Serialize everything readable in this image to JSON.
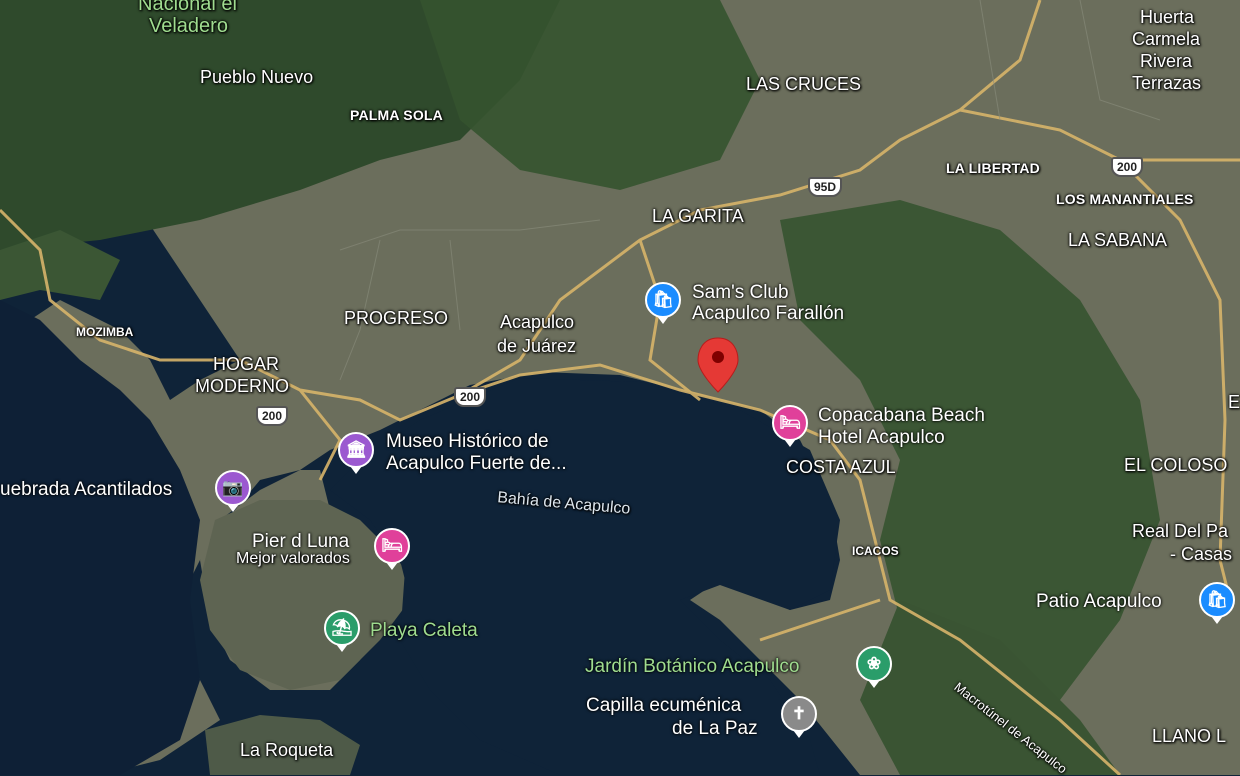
{
  "labels": {
    "nacional": "Nacional el",
    "veladero": "Veladero",
    "pueblo_nuevo": "Pueblo Nuevo",
    "palma_sola": "PALMA SOLA",
    "las_cruces": "LAS CRUCES",
    "huerta": "Huerta",
    "carmela": "Carmela",
    "rivera": "Rivera",
    "terrazas": "Terrazas",
    "la_libertad": "LA LIBERTAD",
    "los_manantiales": "LOS MANANTIALES",
    "la_garita": "LA GARITA",
    "la_sabana": "LA SABANA",
    "mozimba": "MOZIMBA",
    "progreso": "PROGRESO",
    "acapulco_1": "Acapulco",
    "acapulco_2": "de Juárez",
    "hogar": "HOGAR",
    "moderno": "MODERNO",
    "costa_azul": "COSTA AZUL",
    "el_coloso": "EL COLOSO",
    "icacos": "ICACOS",
    "bahia": "Bahía de Acapulco",
    "la_roqueta": "La Roqueta",
    "llano": "LLANO L",
    "real_1": "Real Del Pa",
    "real_2": "- Casas",
    "partial_b": "E"
  },
  "roads": {
    "r95d": "95D",
    "r200a": "200",
    "r200b": "200",
    "r200c": "200",
    "macrotunel": "Macrotúnel de Acapulco"
  },
  "pois": {
    "sams_1": "Sam's Club",
    "sams_2": "Acapulco Farallón",
    "copa_1": "Copacabana Beach",
    "copa_2": "Hotel Acapulco",
    "museo_1": "Museo Histórico de",
    "museo_2": "Acapulco Fuerte de...",
    "quebrada": "uebrada Acantilados",
    "pier_1": "Pier d Luna",
    "pier_2": "Mejor valorados",
    "caleta": "Playa Caleta",
    "jardin": "Jardín Botánico Acapulco",
    "capilla_1": "Capilla ecuménica",
    "capilla_2": "de La Paz",
    "patio": "Patio Acapulco"
  },
  "colors": {
    "water": "#0f2338",
    "land": "#6b6e5c",
    "forest": "#2f4a2c",
    "road": "#d7b46a",
    "shopping": "#1a8cff",
    "hotel": "#e0409a",
    "museum": "#9b59d0",
    "park": "#2a9d6a",
    "church": "#8a8a8a",
    "pin": "#e53935"
  }
}
